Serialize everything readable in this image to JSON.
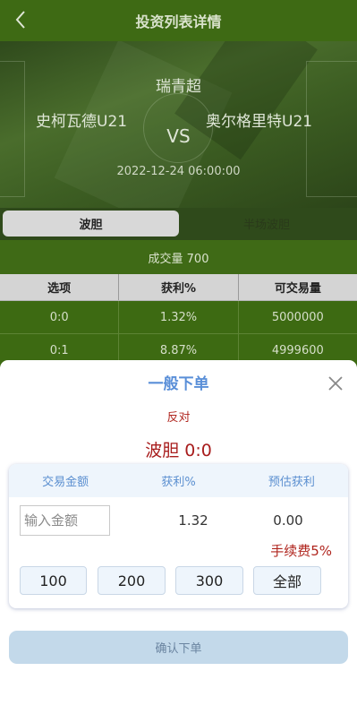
{
  "header": {
    "title": "投资列表详情",
    "back_icon": "chevron-left-icon"
  },
  "match": {
    "league": "瑞青超",
    "home_team": "史柯瓦德U21",
    "vs": "VS",
    "away_team": "奥尔格里特U21",
    "time": "2022-12-24 06:00:00"
  },
  "tabs": [
    {
      "label": "波胆",
      "active": true
    },
    {
      "label": "半场波胆",
      "active": false
    }
  ],
  "volume": "成交量 700",
  "table": {
    "headers": [
      "选项",
      "获利%",
      "可交易量"
    ],
    "rows": [
      [
        "0:0",
        "1.32%",
        "5000000"
      ],
      [
        "0:1",
        "8.87%",
        "4999600"
      ]
    ]
  },
  "order": {
    "title": "一般下单",
    "close_icon": "close-icon",
    "direction": "反对",
    "selection": "波胆 0:0",
    "columns": [
      "交易金额",
      "获利%",
      "预估获利"
    ],
    "amount_placeholder": "输入金额",
    "profit_value": "1.32",
    "estimated_value": "0.00",
    "fee": "手续费5%",
    "quick_amounts": [
      "100",
      "200",
      "300",
      "全部"
    ],
    "confirm_label": "确认下单"
  },
  "colors": {
    "header_bg": "#3e6a14",
    "table_row_bg": "#3d6a12",
    "accent_blue": "#5a8fd8",
    "accent_red": "#b0251e",
    "confirm_bg": "#c3d9ea"
  }
}
